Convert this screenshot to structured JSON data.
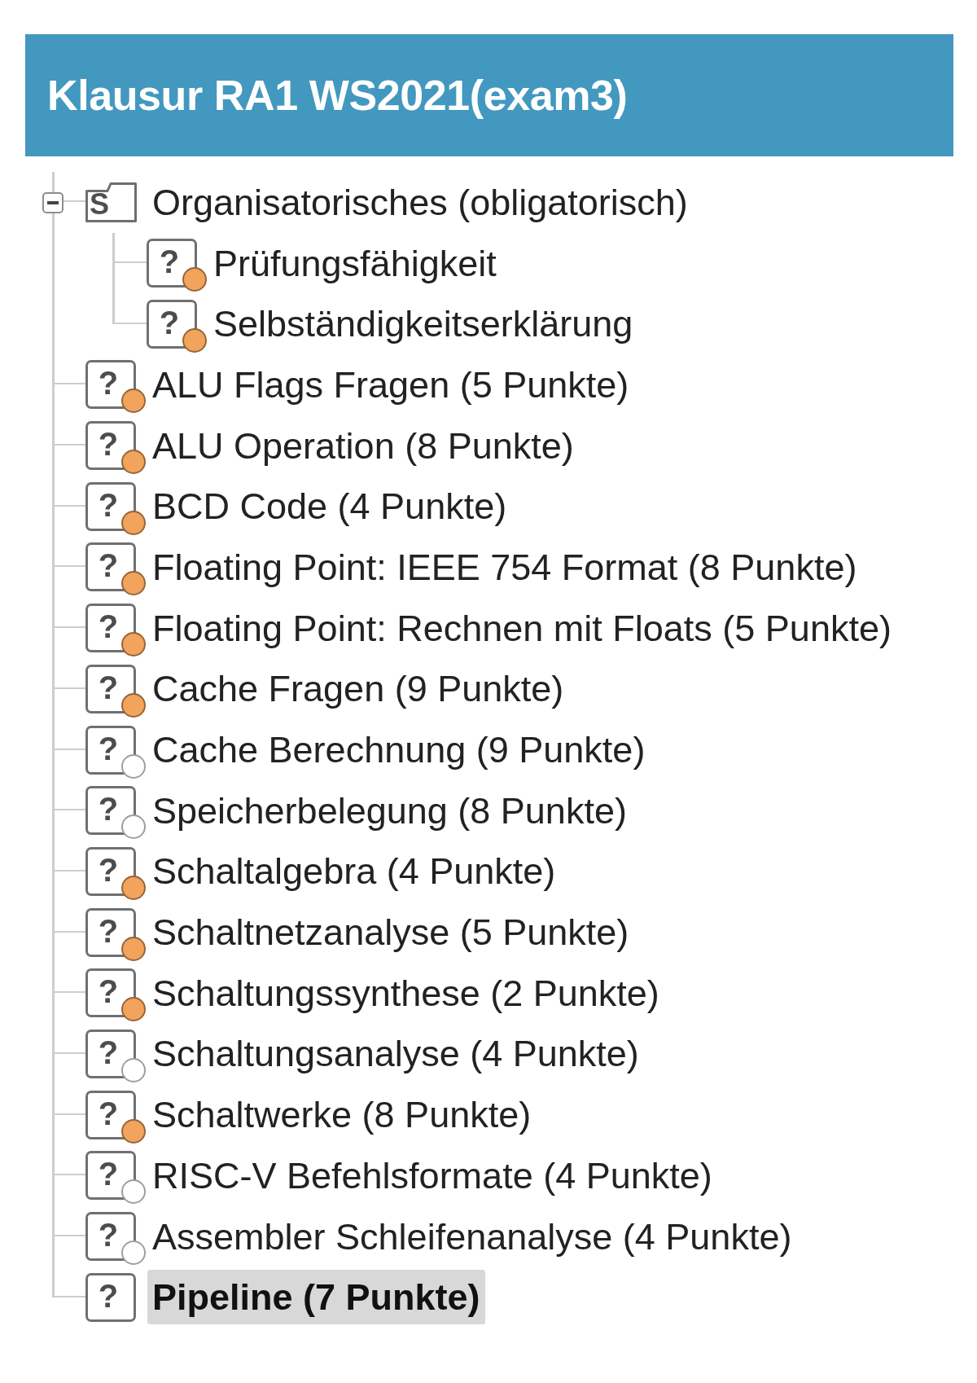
{
  "header": {
    "title": "Klausur RA1 WS2021(exam3)"
  },
  "tree": [
    {
      "kind": "section",
      "glyph": "S",
      "label": "Organisatorisches (obligatorisch)",
      "expanded": true,
      "selected": false,
      "children": [
        {
          "kind": "question",
          "glyph": "?",
          "label": "Prüfungsfähigkeit",
          "selected": false,
          "color": "#f2a35c"
        },
        {
          "kind": "question",
          "glyph": "?",
          "label": "Selbständigkeitserklärung",
          "selected": false,
          "color": "#f2a35c"
        }
      ]
    },
    {
      "kind": "question",
      "glyph": "?",
      "label": "ALU Flags Fragen (5 Punkte)",
      "selected": false,
      "color": "#f2a35c"
    },
    {
      "kind": "question",
      "glyph": "?",
      "label": "ALU Operation (8 Punkte)",
      "selected": false,
      "color": "#f2a35c"
    },
    {
      "kind": "question",
      "glyph": "?",
      "label": "BCD Code (4 Punkte)",
      "selected": false,
      "color": "#f2a35c"
    },
    {
      "kind": "question",
      "glyph": "?",
      "label": "Floating Point: IEEE 754 Format (8 Punkte)",
      "selected": false,
      "color": "#f2a35c"
    },
    {
      "kind": "question",
      "glyph": "?",
      "label": "Floating Point: Rechnen mit Floats (5 Punkte)",
      "selected": false,
      "color": "#f2a35c"
    },
    {
      "kind": "question",
      "glyph": "?",
      "label": "Cache Fragen (9 Punkte)",
      "selected": false,
      "color": "#f2a35c"
    },
    {
      "kind": "question",
      "glyph": "?",
      "label": "Cache Berechnung (9 Punkte)",
      "selected": false,
      "color": "#ffffff"
    },
    {
      "kind": "question",
      "glyph": "?",
      "label": "Speicherbelegung (8 Punkte)",
      "selected": false,
      "color": "#ffffff"
    },
    {
      "kind": "question",
      "glyph": "?",
      "label": "Schaltalgebra (4 Punkte)",
      "selected": false,
      "color": "#f2a35c"
    },
    {
      "kind": "question",
      "glyph": "?",
      "label": "Schaltnetzanalyse (5 Punkte)",
      "selected": false,
      "color": "#f2a35c"
    },
    {
      "kind": "question",
      "glyph": "?",
      "label": "Schaltungssynthese (2 Punkte)",
      "selected": false,
      "color": "#f2a35c"
    },
    {
      "kind": "question",
      "glyph": "?",
      "label": "Schaltungsanalyse (4 Punkte)",
      "selected": false,
      "color": "#ffffff"
    },
    {
      "kind": "question",
      "glyph": "?",
      "label": "Schaltwerke (8 Punkte)",
      "selected": false,
      "color": "#f2a35c"
    },
    {
      "kind": "question",
      "glyph": "?",
      "label": "RISC-V Befehlsformate (4 Punkte)",
      "selected": false,
      "color": "#ffffff"
    },
    {
      "kind": "question",
      "glyph": "?",
      "label": "Assembler Schleifenanalyse (4 Punkte)",
      "selected": false,
      "color": "#ffffff"
    },
    {
      "kind": "question",
      "glyph": "?",
      "label": "Pipeline (7 Punkte)",
      "selected": true
    }
  ]
}
